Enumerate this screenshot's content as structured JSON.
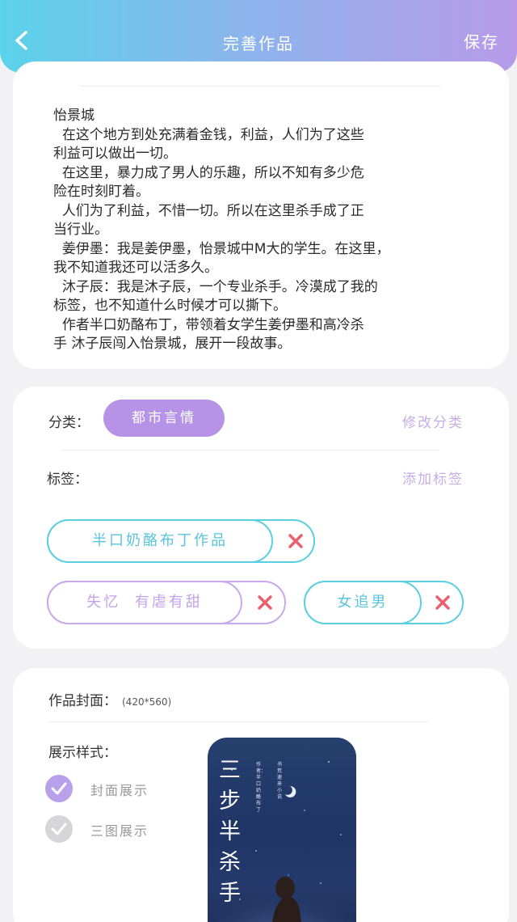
{
  "header": {
    "title": "完善作品",
    "save_label": "保存"
  },
  "intro": {
    "text": "怡景城\n  在这个地方到处充满着金钱，利益，人们为了这些\n利益可以做出一切。\n  在这里，暴力成了男人的乐趣，所以不知有多少危\n险在时刻盯着。\n  人们为了利益，不惜一切。所以在这里杀手成了正\n当行业。\n  姜伊墨：我是姜伊墨，怡景城中M大的学生。在这里，\n我不知道我还可以活多久。\n  沐子辰：我是沐子辰，一个专业杀手。冷漠成了我的\n标签，也不知道什么时候才可以撕下。\n  作者半口奶酪布丁，带领着女学生姜伊墨和高冷杀\n手 沐子辰闯入怡景城，展开一段故事。"
  },
  "category": {
    "label": "分类：",
    "value": "都市言情",
    "edit_label": "修改分类"
  },
  "tags": {
    "label": "标签：",
    "add_label": "添加标签",
    "items": [
      {
        "text": "半口奶酪布丁作品",
        "color": "#5bcfe2"
      },
      {
        "text": "失忆  有虐有甜",
        "color": "#c9a8ec"
      },
      {
        "text": "女追男",
        "color": "#5bcfe2"
      }
    ]
  },
  "cover": {
    "title": "作品封面：",
    "size": "(420*560)",
    "style_label": "展示样式：",
    "options": [
      {
        "label": "封面展示",
        "checked": true
      },
      {
        "label": "三图展示",
        "checked": false
      }
    ],
    "image": {
      "title_chars": "三步半杀手",
      "author_line": "作者：半口奶酪布丁",
      "subtitle": "书荒速来小说"
    }
  },
  "colors": {
    "header_gradient": [
      "#5bd3ea",
      "#8fb3ec",
      "#b89ae8"
    ],
    "accent_purple": "#b693e6",
    "accent_cyan": "#5bcfe2",
    "remove_red": "#ec5f6f"
  }
}
